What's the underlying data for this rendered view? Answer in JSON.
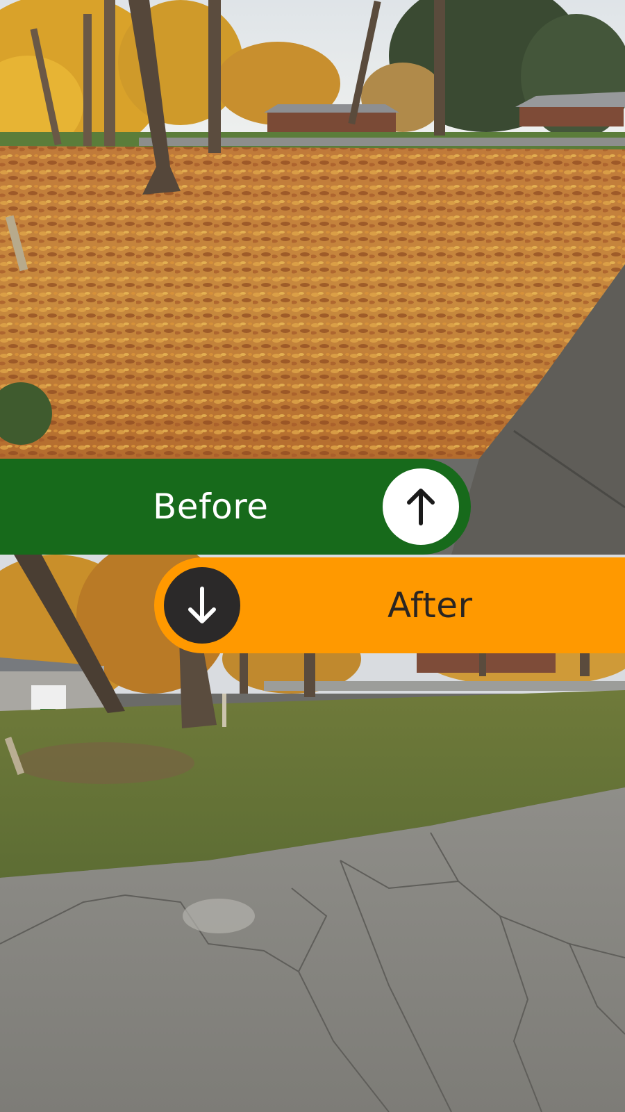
{
  "before": {
    "label": "Before",
    "icon": "arrow-up-icon",
    "banner_color": "#176a1b",
    "button_color": "#ffffff"
  },
  "after": {
    "label": "After",
    "icon": "arrow-down-icon",
    "banner_color": "#ff9900",
    "button_color": "#2b2929"
  }
}
